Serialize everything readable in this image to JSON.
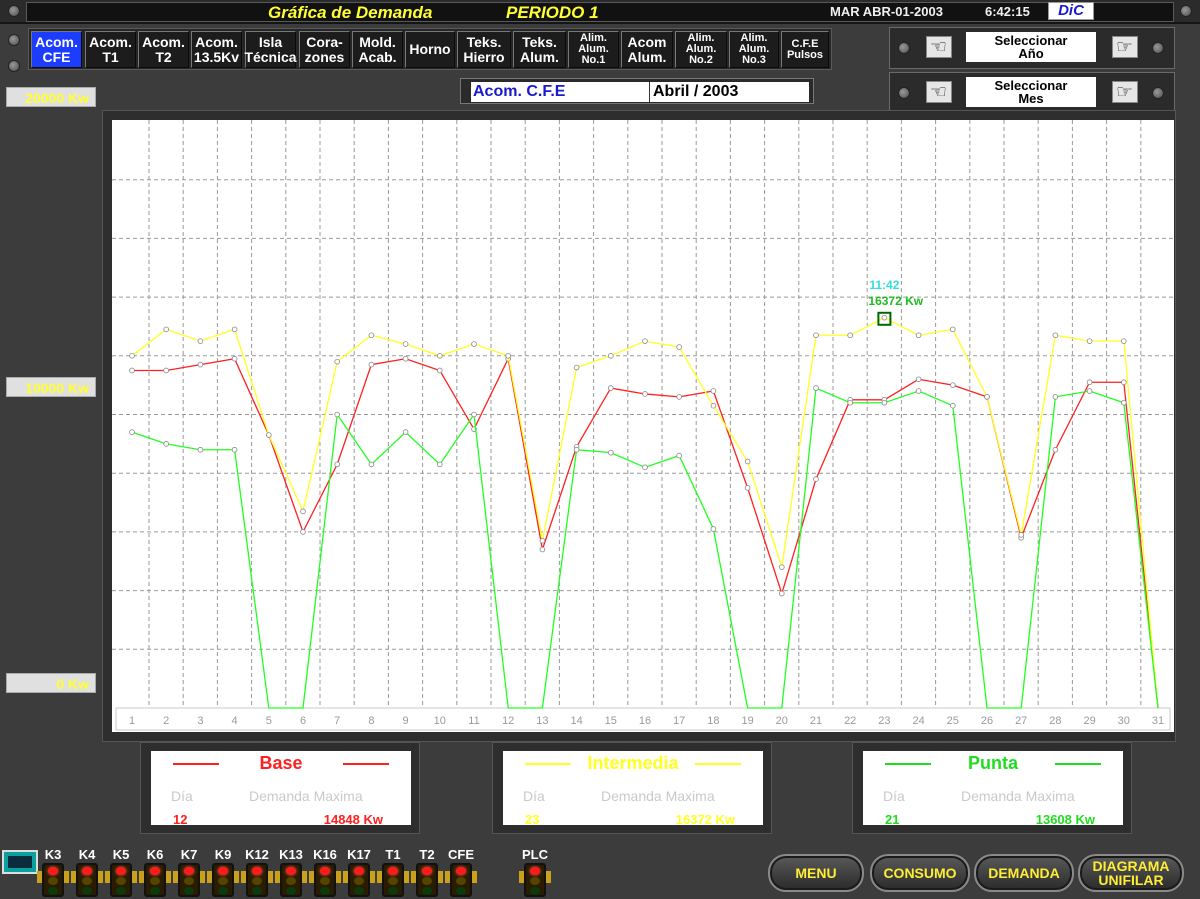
{
  "titlebar": {
    "title": "Gráfica de Demanda",
    "period": "PERIODO 1",
    "date": "MAR ABR-01-2003",
    "time": "6:42:15",
    "logo": "DiC"
  },
  "tabs": [
    {
      "label": "Acom.\nCFE",
      "active": true
    },
    {
      "label": "Acom.\nT1"
    },
    {
      "label": "Acom.\nT2"
    },
    {
      "label": "Acom.\n13.5Kv"
    },
    {
      "label": "Isla\nTécnica"
    },
    {
      "label": "Cora-\nzones"
    },
    {
      "label": "Mold.\nAcab."
    },
    {
      "label": "Horno"
    },
    {
      "label": "Teks.\nHierro"
    },
    {
      "label": "Teks.\nAlum."
    },
    {
      "label": "Alim.\nAlum.\nNo.1"
    },
    {
      "label": "Acom\nAlum."
    },
    {
      "label": "Alim.\nAlum.\nNo.2"
    },
    {
      "label": "Alim.\nAlum.\nNo.3"
    },
    {
      "label": "C.F.E\nPulsos"
    }
  ],
  "selectors": {
    "year_label": "Seleccionar\nAño",
    "month_label": "Seleccionar\nMes"
  },
  "info": {
    "name": "Acom. C.F.E",
    "month": "Abril / 2003"
  },
  "yaxis": {
    "top": "20000 Kw",
    "mid": "10000 Kw",
    "bottom": "0 Kw"
  },
  "chart_data": {
    "type": "line",
    "x": [
      1,
      2,
      3,
      4,
      5,
      6,
      7,
      8,
      9,
      10,
      11,
      12,
      13,
      14,
      15,
      16,
      17,
      18,
      19,
      20,
      21,
      22,
      23,
      24,
      25,
      26,
      27,
      28,
      29,
      30,
      31
    ],
    "ylim": [
      0,
      20000
    ],
    "grid": true,
    "series": [
      {
        "name": "Base",
        "color": "#ff2020",
        "values": [
          11500,
          11500,
          11700,
          11900,
          9300,
          6000,
          8300,
          11700,
          11900,
          11500,
          9500,
          11900,
          5400,
          8900,
          10900,
          10700,
          10600,
          10800,
          7500,
          3900,
          7800,
          10500,
          10500,
          11200,
          11000,
          10600,
          5800,
          8800,
          11100,
          11100,
          0
        ]
      },
      {
        "name": "Intermedia",
        "color": "#ffff20",
        "values": [
          12000,
          12900,
          12500,
          12900,
          9300,
          6700,
          11800,
          12700,
          12400,
          12000,
          12400,
          12000,
          5700,
          11600,
          12000,
          12500,
          12300,
          10300,
          8400,
          4800,
          12700,
          12700,
          13300,
          12700,
          12900,
          10600,
          5900,
          12700,
          12500,
          12500,
          0
        ]
      },
      {
        "name": "Punta",
        "color": "#20ff20",
        "values": [
          9400,
          9000,
          8800,
          8800,
          0,
          0,
          10000,
          8300,
          9400,
          8300,
          10000,
          0,
          0,
          8800,
          8700,
          8200,
          8600,
          6100,
          0,
          0,
          10900,
          10400,
          10400,
          10800,
          10300,
          0,
          0,
          10600,
          10800,
          10400,
          0
        ]
      }
    ],
    "marker": {
      "day": 23,
      "value": 16372,
      "time": "11:42",
      "label": "16372 Kw"
    }
  },
  "legend": [
    {
      "title": "Base",
      "color": "#ff2020",
      "h1": "Día",
      "h2": "Demanda Maxima",
      "day": "12",
      "value": "14848 Kw"
    },
    {
      "title": "Intermedia",
      "color": "#ffff20",
      "h1": "Día",
      "h2": "Demanda Maxima",
      "day": "23",
      "value": "16372 Kw"
    },
    {
      "title": "Punta",
      "color": "#20dd20",
      "h1": "Día",
      "h2": "Demanda Maxima",
      "day": "21",
      "value": "13608 Kw"
    }
  ],
  "plcs": [
    "K3",
    "K4",
    "K5",
    "K6",
    "K7",
    "K9",
    "K12",
    "K13",
    "K16",
    "K17",
    "T1",
    "T2",
    "CFE"
  ],
  "plc_main": "PLC",
  "nav": {
    "menu": "MENU",
    "consumo": "CONSUMO",
    "demanda": "DEMANDA",
    "diagrama": "DIAGRAMA\nUNIFILAR"
  }
}
